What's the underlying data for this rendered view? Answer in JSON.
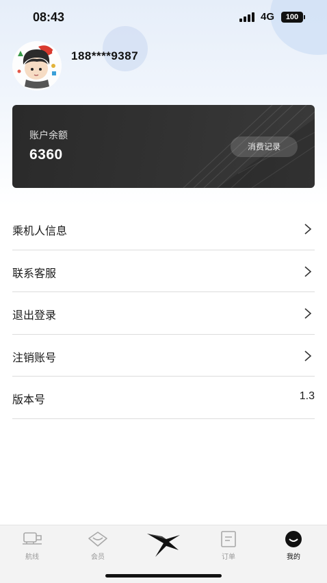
{
  "status_bar": {
    "time": "08:43",
    "network": "4G",
    "battery": "100"
  },
  "profile": {
    "phone": "188****9387"
  },
  "balance_card": {
    "label": "账户余额",
    "value": "6360",
    "records_button": "消费记录"
  },
  "menu": {
    "items": [
      {
        "label": "乘机人信息",
        "icon": "chevron-right-icon"
      },
      {
        "label": "联系客服",
        "icon": "chevron-right-icon"
      },
      {
        "label": "退出登录",
        "icon": "chevron-right-icon"
      },
      {
        "label": "注销账号",
        "icon": "chevron-right-icon"
      },
      {
        "label": "版本号",
        "value": "1.3"
      }
    ]
  },
  "tab_bar": {
    "tabs": [
      {
        "label": "航线",
        "icon": "plane-icon",
        "active": false
      },
      {
        "label": "会员",
        "icon": "diamond-icon",
        "active": false
      },
      {
        "label": "",
        "icon": "app-logo-icon",
        "active": false
      },
      {
        "label": "订单",
        "icon": "order-icon",
        "active": false
      },
      {
        "label": "我的",
        "icon": "profile-icon",
        "active": true
      }
    ]
  },
  "colors": {
    "card_background": "#2f2f2f",
    "text_primary": "#1a1a1a",
    "tab_inactive": "#9a9a9a",
    "tab_active": "#111111"
  }
}
